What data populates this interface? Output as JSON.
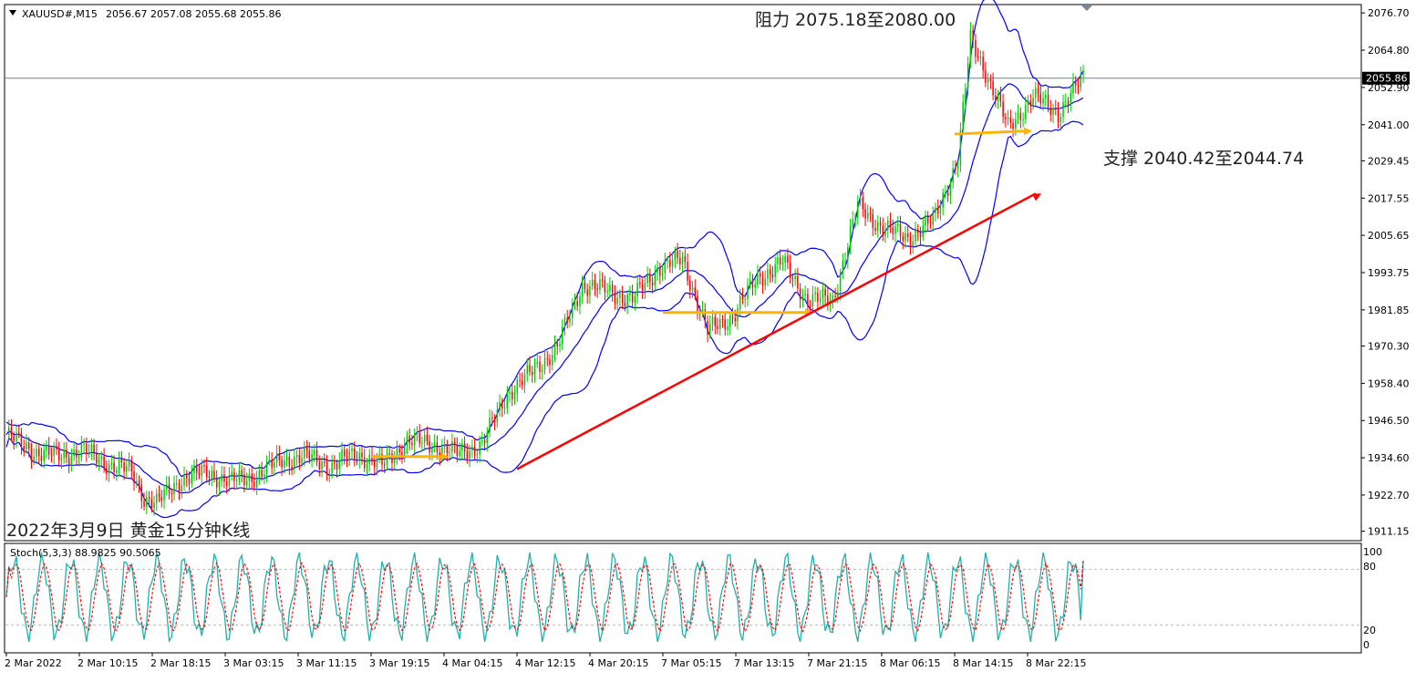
{
  "header": {
    "symbol": "XAUUSD#,M15",
    "ohlc": "2056.67 2057.08 2055.68 2055.86",
    "menu_icon": "triangle-down-icon"
  },
  "colors": {
    "candle_bull": "#00c800",
    "candle_bear": "#ff0000",
    "bollinger": "#0000ff",
    "support_arrow": "#ffb400",
    "trend_arrow": "#ff0000",
    "price_line": "#708090",
    "stoch_main": "#20b2aa",
    "stoch_signal": "#ff0000"
  },
  "annotations": {
    "resistance": "阻力 2075.18至2080.00",
    "support": "支撑 2040.42至2044.74",
    "caption": "2022年3月9日 黄金15分钟K线"
  },
  "stoch": {
    "label": "Stoch(5,3,3) 88.9825 90.5065",
    "levels": [
      "100",
      "80",
      "20",
      "0"
    ]
  },
  "chart_data": {
    "type": "candlestick",
    "title": "",
    "symbol": "XAUUSD#",
    "timeframe": "M15",
    "current_price": 2055.86,
    "price_axis_labels": [
      "2076.70",
      "2064.80",
      "2052.90",
      "2041.00",
      "2029.45",
      "2017.55",
      "2005.65",
      "1993.75",
      "1981.85",
      "1970.30",
      "1958.40",
      "1946.50",
      "1934.60",
      "1922.70",
      "1911.15"
    ],
    "current_price_label": "2055.86",
    "ylim": [
      1909,
      2078.5
    ],
    "x_labels": [
      "2 Mar 2022",
      "2 Mar 10:15",
      "2 Mar 18:15",
      "3 Mar 03:15",
      "3 Mar 11:15",
      "3 Mar 19:15",
      "4 Mar 04:15",
      "4 Mar 12:15",
      "4 Mar 20:15",
      "7 Mar 05:15",
      "7 Mar 13:15",
      "7 Mar 21:15",
      "8 Mar 06:15",
      "8 Mar 14:15",
      "8 Mar 22:15"
    ],
    "approx_close_path": [
      [
        0,
        1942
      ],
      [
        10,
        1937
      ],
      [
        20,
        1935
      ],
      [
        30,
        1937
      ],
      [
        40,
        1933
      ],
      [
        50,
        1930
      ],
      [
        55,
        1922
      ],
      [
        60,
        1920
      ],
      [
        70,
        1928
      ],
      [
        80,
        1930
      ],
      [
        90,
        1927
      ],
      [
        100,
        1929
      ],
      [
        110,
        1934
      ],
      [
        120,
        1935
      ],
      [
        130,
        1932
      ],
      [
        140,
        1936
      ],
      [
        150,
        1932
      ],
      [
        160,
        1940
      ],
      [
        170,
        1939
      ],
      [
        180,
        1936
      ],
      [
        190,
        1939
      ],
      [
        200,
        1955
      ],
      [
        210,
        1962
      ],
      [
        220,
        1970
      ],
      [
        230,
        1990
      ],
      [
        240,
        1988
      ],
      [
        250,
        1985
      ],
      [
        260,
        1995
      ],
      [
        270,
        1998
      ],
      [
        280,
        1975
      ],
      [
        290,
        1980
      ],
      [
        300,
        1992
      ],
      [
        310,
        1997
      ],
      [
        320,
        1985
      ],
      [
        330,
        1985
      ],
      [
        340,
        2015
      ],
      [
        350,
        2008
      ],
      [
        360,
        2005
      ],
      [
        370,
        2010
      ],
      [
        380,
        2030
      ],
      [
        385,
        2068
      ],
      [
        390,
        2060
      ],
      [
        400,
        2040
      ],
      [
        410,
        2050
      ],
      [
        420,
        2045
      ],
      [
        430,
        2055.86
      ]
    ],
    "indicators": {
      "bollinger_bands": true,
      "stochastic": {
        "params": "5,3,3",
        "main": 88.9825,
        "signal": 90.5065,
        "levels": [
          20,
          80
        ]
      }
    },
    "overlays": [
      {
        "kind": "support-arrow",
        "from": [
          "3 Mar 19:15",
          1935
        ],
        "to": [
          "4 Mar 04:15",
          1935
        ]
      },
      {
        "kind": "support-arrow",
        "from": [
          "7 Mar 05:15",
          1981
        ],
        "to": [
          "7 Mar 21:15",
          1981
        ]
      },
      {
        "kind": "support-arrow",
        "from": [
          "8 Mar 14:15",
          2038
        ],
        "to": [
          "8 Mar 22:15",
          2039
        ]
      },
      {
        "kind": "trend-arrow",
        "from": [
          "4 Mar 12:15",
          1931
        ],
        "to": [
          "8 Mar 22:15",
          2019
        ]
      }
    ],
    "grid": false,
    "legend": "none"
  }
}
